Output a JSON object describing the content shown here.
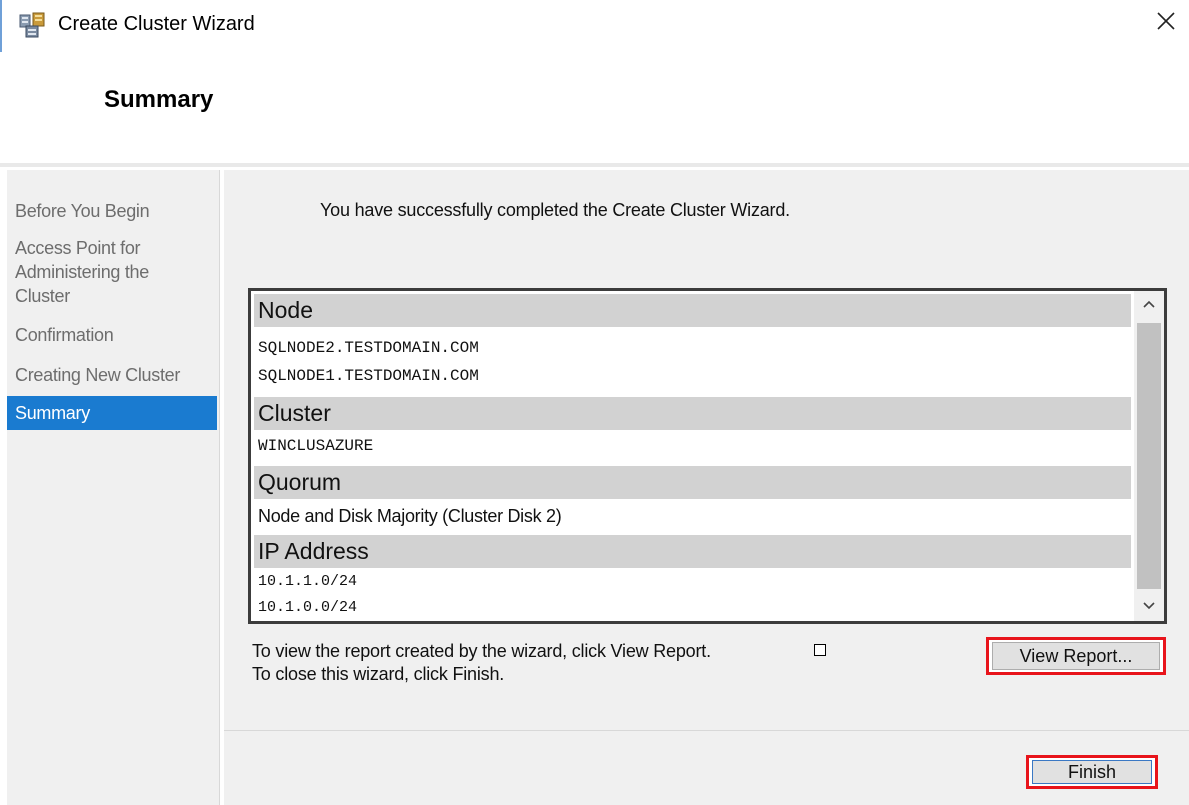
{
  "window": {
    "title": "Create Cluster Wizard",
    "icon": "cluster-wizard-icon",
    "close_icon": "close-icon"
  },
  "header": {
    "page_title": "Summary"
  },
  "sidebar": {
    "items": [
      {
        "label": "Before You Begin",
        "active": false
      },
      {
        "label": "Access Point for Administering the Cluster",
        "active": false
      },
      {
        "label": "Confirmation",
        "active": false
      },
      {
        "label": "Creating New Cluster",
        "active": false
      },
      {
        "label": "Summary",
        "active": true
      }
    ]
  },
  "main": {
    "success_message": "You have successfully completed the Create Cluster Wizard.",
    "report": {
      "node_header": "Node",
      "nodes": [
        "SQLNODE2.TESTDOMAIN.COM",
        "SQLNODE1.TESTDOMAIN.COM"
      ],
      "cluster_header": "Cluster",
      "cluster_name": "WINCLUSAZURE",
      "quorum_header": "Quorum",
      "quorum_value": "Node and Disk Majority (Cluster Disk 2)",
      "ip_header": "IP Address",
      "ip_addresses": [
        "10.1.1.0/24",
        "10.1.0.0/24"
      ]
    },
    "info_line1": "To view the report created by the wizard, click View Report.",
    "info_line2": "To close this wizard, click Finish.",
    "view_report_label": "View Report..."
  },
  "footer": {
    "finish_label": "Finish"
  },
  "colors": {
    "accent": "#1a7bd0",
    "highlight_border": "#e8141b",
    "section_header_bg": "#d2d2d2",
    "panel_bg": "#f0f0f0"
  }
}
